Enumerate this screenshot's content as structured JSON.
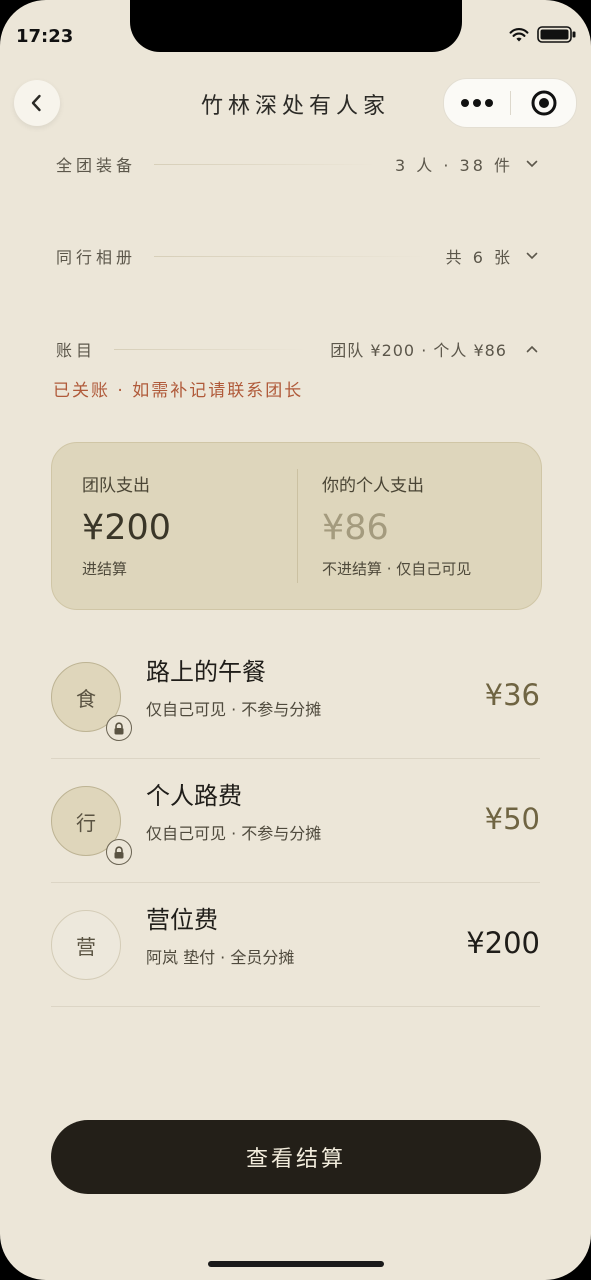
{
  "status_bar": {
    "time": "17:23"
  },
  "nav": {
    "title": "竹林深处有人家",
    "back_icon": "chevron-left-icon",
    "more_icon": "more-dots-icon",
    "close_icon": "target-circle-icon"
  },
  "sections": [
    {
      "label": "全团装备",
      "value": "3 人 · 38 件",
      "expanded": false
    },
    {
      "label": "同行相册",
      "value": "共 6 张",
      "expanded": false
    },
    {
      "label": "账目",
      "value": "团队 ¥200 · 个人 ¥86",
      "expanded": true
    }
  ],
  "ledger": {
    "closed_note": "已关账 · 如需补记请联系团长",
    "summary": {
      "team_label": "团队支出",
      "team_amount": "¥200",
      "team_note": "进结算",
      "personal_label": "你的个人支出",
      "personal_amount": "¥86",
      "personal_note": "不进结算 · 仅自己可见"
    },
    "items": [
      {
        "icon_char": "食",
        "title": "路上的午餐",
        "subtitle": "仅自己可见 · 不参与分摊",
        "amount": "¥36",
        "private": true
      },
      {
        "icon_char": "行",
        "title": "个人路费",
        "subtitle": "仅自己可见 · 不参与分摊",
        "amount": "¥50",
        "private": true
      },
      {
        "icon_char": "营",
        "title": "营位费",
        "subtitle": "阿岚 垫付 · 全员分摊",
        "amount": "¥200",
        "private": false
      }
    ]
  },
  "primary_button": {
    "label": "查看结算"
  },
  "colors": {
    "background": "#ece6d8",
    "accent_warning": "#b05a3a",
    "button": "#231f18",
    "card": "#ded6bc"
  }
}
